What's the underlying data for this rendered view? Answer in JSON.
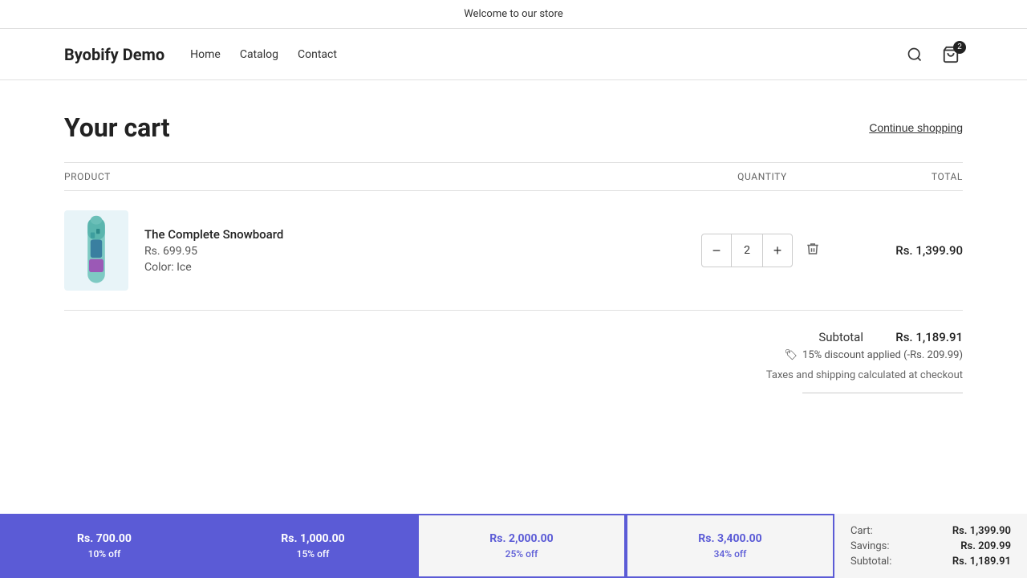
{
  "announcement": {
    "text": "Welcome to our store"
  },
  "header": {
    "logo": "Byobify Demo",
    "nav": [
      {
        "label": "Home"
      },
      {
        "label": "Catalog"
      },
      {
        "label": "Contact"
      }
    ],
    "cart_count": "2"
  },
  "page": {
    "title": "Your cart",
    "continue_shopping": "Continue shopping"
  },
  "table": {
    "col_product": "PRODUCT",
    "col_quantity": "QUANTITY",
    "col_total": "TOTAL"
  },
  "cart_item": {
    "name": "The Complete Snowboard",
    "price": "Rs. 699.95",
    "color_label": "Color:",
    "color_value": "Ice",
    "quantity": "2",
    "total": "Rs. 1,399.90"
  },
  "summary": {
    "subtotal_label": "Subtotal",
    "subtotal_value": "Rs. 1,189.91",
    "discount_text": "15% discount applied (-Rs. 209.99)",
    "taxes_note": "Taxes and shipping calculated at checkout"
  },
  "discount_tiers": [
    {
      "amount": "Rs. 700.00",
      "pct": "10% off",
      "filled": true
    },
    {
      "amount": "Rs. 1,000.00",
      "pct": "15% off",
      "filled": true
    },
    {
      "amount": "Rs. 2,000.00",
      "pct": "25% off",
      "filled": false
    },
    {
      "amount": "Rs. 3,400.00",
      "pct": "34% off",
      "filled": false
    }
  ],
  "mini_summary": {
    "cart_label": "Cart:",
    "cart_value": "Rs. 1,399.90",
    "savings_label": "Savings:",
    "savings_value": "Rs. 209.99",
    "subtotal_label": "Subtotal:",
    "subtotal_value": "Rs. 1,189.91"
  }
}
